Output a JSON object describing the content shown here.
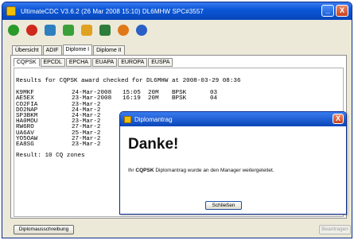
{
  "window": {
    "title": "UltimateCDC V3.6.2 (26 Mar 2008 15:10) DL6MHW SPC#3557",
    "min_label": "_",
    "close_label": "X"
  },
  "toolbar": {
    "icons": [
      {
        "name": "record-icon",
        "color": "#2a9a2a"
      },
      {
        "name": "stop-icon",
        "color": "#d0281c"
      },
      {
        "name": "users-icon",
        "color": "#2e7fc0"
      },
      {
        "name": "network-icon",
        "color": "#3aa03a"
      },
      {
        "name": "book-icon",
        "color": "#e0a020"
      },
      {
        "name": "monitor-icon",
        "color": "#2d7d3a"
      },
      {
        "name": "globe-orange-icon",
        "color": "#e07818"
      },
      {
        "name": "globe-blue-icon",
        "color": "#2a5fc8"
      }
    ]
  },
  "tabs_main": [
    "Übersicht",
    "ADIF",
    "Diplome I",
    "Diplome II"
  ],
  "tabs_sub": [
    "CQPSK",
    "EPCDL",
    "EPCHA",
    "EUAPA",
    "EUROPA",
    "EUSPA"
  ],
  "results": {
    "header": "Results for CQPSK award checked for DL6MHW at 2008-03-29 08:36",
    "rows": [
      {
        "call": "K9MKF",
        "date": "24-Mar-2008",
        "time": "15:05",
        "band": "20M",
        "mode": "BPSK",
        "zone": "03"
      },
      {
        "call": "AE5EX",
        "date": "23-Mar-2008",
        "time": "16:19",
        "band": "20M",
        "mode": "BPSK",
        "zone": "04"
      },
      {
        "call": "CO2FIA",
        "date": "23-Mar-2",
        "time": "",
        "band": "",
        "mode": "",
        "zone": ""
      },
      {
        "call": "DO2NAP",
        "date": "24-Mar-2",
        "time": "",
        "band": "",
        "mode": "",
        "zone": ""
      },
      {
        "call": "SP3BKM",
        "date": "24-Mar-2",
        "time": "",
        "band": "",
        "mode": "",
        "zone": ""
      },
      {
        "call": "HA0MOU",
        "date": "23-Mar-2",
        "time": "",
        "band": "",
        "mode": "",
        "zone": ""
      },
      {
        "call": "RW6RO",
        "date": "27-Mar-2",
        "time": "",
        "band": "",
        "mode": "",
        "zone": ""
      },
      {
        "call": "UA6AV",
        "date": "25-Mar-2",
        "time": "",
        "band": "",
        "mode": "",
        "zone": ""
      },
      {
        "call": "YO5OAW",
        "date": "27-Mar-2",
        "time": "",
        "band": "",
        "mode": "",
        "zone": ""
      },
      {
        "call": "EA8SG",
        "date": "23-Mar-2",
        "time": "",
        "band": "",
        "mode": "",
        "zone": ""
      }
    ],
    "footer": "Result: 10 CQ zones"
  },
  "buttons": {
    "diploma_request": "Diplomausschreibung",
    "disabled_right": "Beantragen"
  },
  "dialog": {
    "title": "Diplomantrag",
    "close_label": "X",
    "heading": "Danke!",
    "message_pre": "Ihr",
    "message_bold": "CQPSK",
    "message_post": "Diplomantrag wurde an den Manager weitergeleitet.",
    "button": "Schließen"
  }
}
